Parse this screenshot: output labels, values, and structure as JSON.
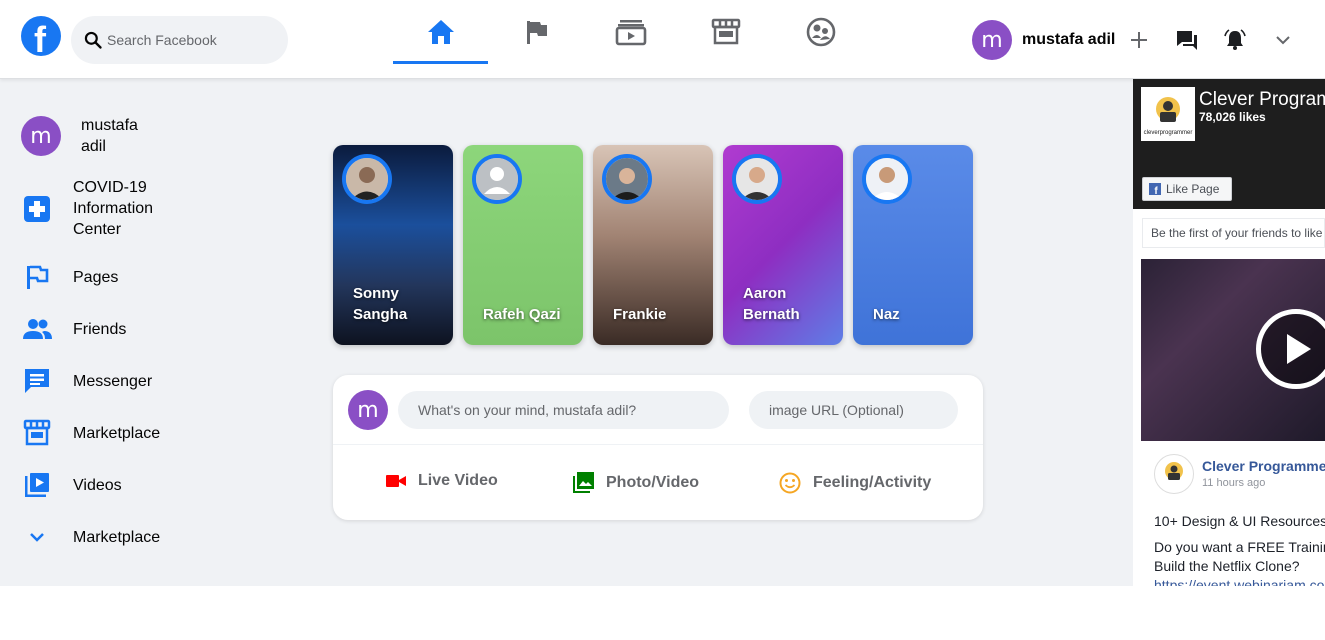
{
  "header": {
    "logo_letter": "f",
    "search_placeholder": "Search Facebook",
    "user_initial": "m",
    "user_name": "mustafa adil"
  },
  "sidebar": {
    "profile_initial": "m",
    "profile_name": "mustafa adil",
    "items": [
      {
        "label": "COVID-19 Information Center",
        "icon": "covid-center-icon"
      },
      {
        "label": "Pages",
        "icon": "flag-icon"
      },
      {
        "label": "Friends",
        "icon": "friends-icon"
      },
      {
        "label": "Messenger",
        "icon": "messenger-icon"
      },
      {
        "label": "Marketplace",
        "icon": "storefront-icon"
      },
      {
        "label": "Videos",
        "icon": "video-library-icon"
      },
      {
        "label": "Marketplace",
        "icon": "chevron-down-icon"
      }
    ]
  },
  "stories": [
    {
      "name": "Sonny Sangha"
    },
    {
      "name": "Rafeh Qazi"
    },
    {
      "name": "Frankie"
    },
    {
      "name": "Aaron Bernath"
    },
    {
      "name": "Naz"
    }
  ],
  "composer": {
    "avatar_initial": "m",
    "message_placeholder": "What's on your mind, mustafa adil?",
    "image_placeholder": "image URL (Optional)",
    "options": [
      {
        "label": "Live Video",
        "color": "#ff0000"
      },
      {
        "label": "Photo/Video",
        "color": "#008000"
      },
      {
        "label": "Feeling/Activity",
        "color": "#f5a623"
      }
    ]
  },
  "widget": {
    "page_title": "Clever Programmer",
    "page_likes": "78,026 likes",
    "page_logo_text": "cleverprogrammer",
    "like_button": "Like Page",
    "friends_text": "Be the first of your friends to like this",
    "post_author": "Clever Programmer",
    "post_time": "11 hours ago",
    "post_line1": "10+ Design & UI Resources",
    "post_line2": "Do you want a FREE Training",
    "post_line3": "Build the Netflix Clone?",
    "post_link": "https://event.webinarjam.com"
  },
  "colors": {
    "brand_blue": "#1877f2",
    "avatar_purple": "#8a4fc5",
    "page_bg": "#f0f2f5"
  }
}
